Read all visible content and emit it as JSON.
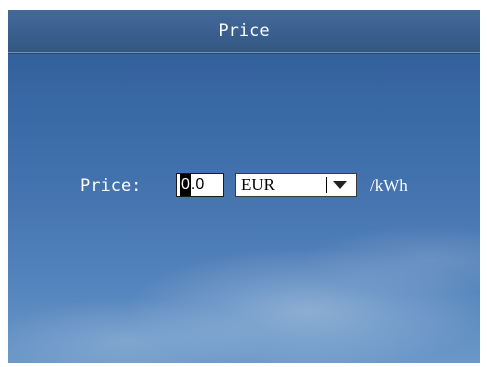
{
  "header": {
    "title": "Price"
  },
  "form": {
    "price_label": "Price:",
    "price_value_first_char": "0",
    "price_value_rest": ".0",
    "currency": "EUR",
    "unit": "/kWh"
  },
  "icons": {
    "dropdown": "chevron-down-icon"
  }
}
